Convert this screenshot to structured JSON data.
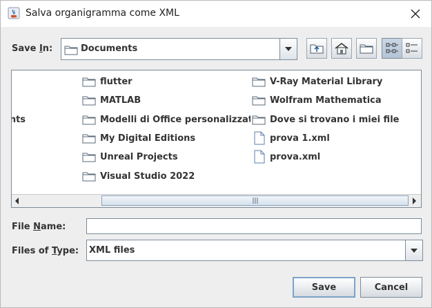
{
  "window": {
    "title": "Salva organigramma come XML"
  },
  "save_in": {
    "label_pre": "Save ",
    "label_mn": "I",
    "label_post": "n:",
    "value": "Documents"
  },
  "toolbar": {
    "buttons": [
      {
        "icon": "up-folder-icon"
      },
      {
        "icon": "home-icon"
      },
      {
        "icon": "new-folder-icon"
      },
      {
        "icon": "list-view-icon"
      },
      {
        "icon": "details-view-icon"
      }
    ]
  },
  "file_list": {
    "cut_item": "ents",
    "items": [
      {
        "name": "flutter",
        "type": "folder"
      },
      {
        "name": "MATLAB",
        "type": "folder"
      },
      {
        "name": "Modelli di Office personalizzati",
        "type": "folder"
      },
      {
        "name": "My Digital Editions",
        "type": "folder"
      },
      {
        "name": "Unreal Projects",
        "type": "folder"
      },
      {
        "name": "Visual Studio 2022",
        "type": "folder"
      },
      {
        "name": "V-Ray Material Library",
        "type": "folder"
      },
      {
        "name": "Wolfram Mathematica",
        "type": "folder"
      },
      {
        "name": "Dove si trovano i miei file",
        "type": "folder"
      },
      {
        "name": "prova 1.xml",
        "type": "file"
      },
      {
        "name": "prova.xml",
        "type": "file"
      }
    ]
  },
  "file_name": {
    "label_pre": "File ",
    "label_mn": "N",
    "label_post": "ame:",
    "value": ""
  },
  "files_of_type": {
    "label_pre": "Files of ",
    "label_mn": "T",
    "label_post": "ype:",
    "value": "XML files"
  },
  "buttons": {
    "save": "Save",
    "cancel": "Cancel"
  }
}
